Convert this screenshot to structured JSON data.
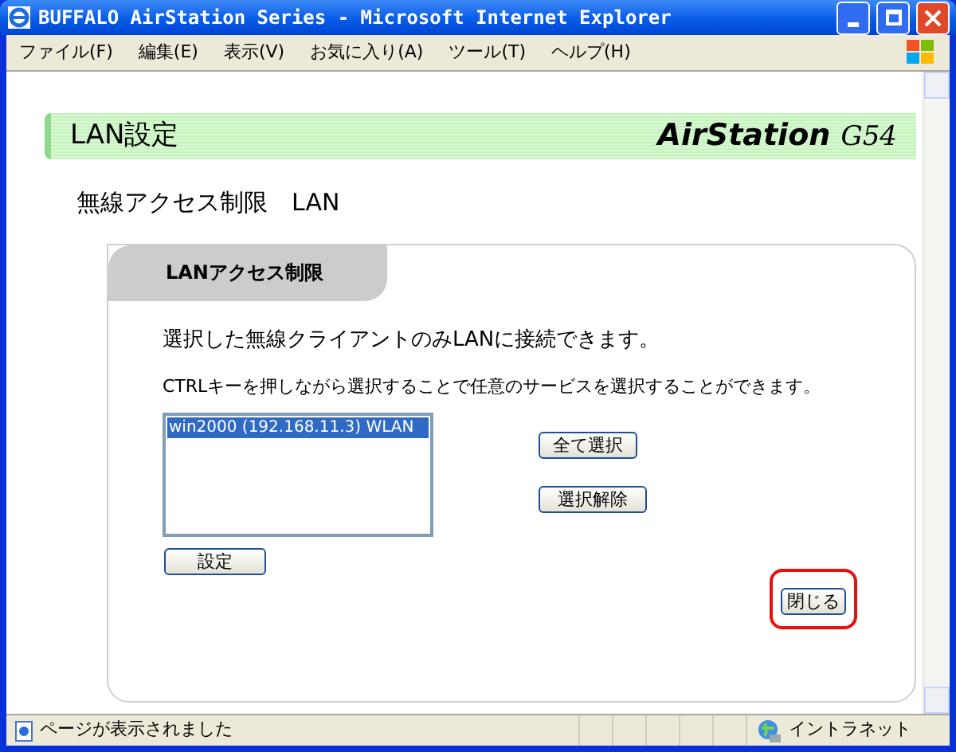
{
  "window": {
    "title": "BUFFALO AirStation Series - Microsoft Internet Explorer"
  },
  "menu": [
    "ファイル(F)",
    "編集(E)",
    "表示(V)",
    "お気に入り(A)",
    "ツール(T)",
    "ヘルプ(H)"
  ],
  "banner": {
    "title": "LAN設定",
    "logo": "AirStation",
    "logo_model": "G54"
  },
  "heading": "無線アクセス制限　LAN",
  "card": {
    "tab": "LANアクセス制限",
    "description": "選択した無線クライアントのみLANに接続できます。",
    "hint": "CTRLキーを押しながら選択することで任意のサービスを選択することができます。",
    "list": [
      {
        "label": "win2000 (192.168.11.3) WLAN",
        "selected": true
      }
    ],
    "select_all": "全て選択",
    "deselect": "選択解除",
    "apply": "設定",
    "close": {
      "label": "閉じる",
      "highlighted": true
    }
  },
  "status_bar": {
    "text": "ページが表示されました",
    "zone": "イントラネット"
  }
}
